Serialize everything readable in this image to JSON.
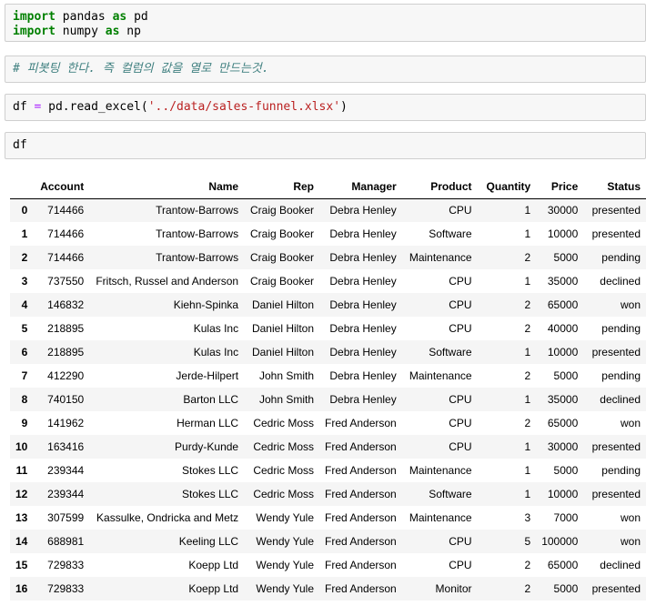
{
  "cells": {
    "import_code": {
      "line1": {
        "kw1": "import",
        "mod": " pandas ",
        "kw2": "as",
        "alias": " pd"
      },
      "line2": {
        "kw1": "import",
        "mod": " numpy ",
        "kw2": "as",
        "alias": " np"
      }
    },
    "comment": "# 피봇팅 한다. 즉 컬럼의 값을 열로 만드는것.",
    "read_code": {
      "pre": "df ",
      "eq": "=",
      "call": " pd.read_excel(",
      "str": "'../data/sales-funnel.xlsx'",
      "post": ")"
    },
    "df_code": "df"
  },
  "table": {
    "columns": [
      "",
      "Account",
      "Name",
      "Rep",
      "Manager",
      "Product",
      "Quantity",
      "Price",
      "Status"
    ],
    "rows": [
      [
        "0",
        "714466",
        "Trantow-Barrows",
        "Craig Booker",
        "Debra Henley",
        "CPU",
        "1",
        "30000",
        "presented"
      ],
      [
        "1",
        "714466",
        "Trantow-Barrows",
        "Craig Booker",
        "Debra Henley",
        "Software",
        "1",
        "10000",
        "presented"
      ],
      [
        "2",
        "714466",
        "Trantow-Barrows",
        "Craig Booker",
        "Debra Henley",
        "Maintenance",
        "2",
        "5000",
        "pending"
      ],
      [
        "3",
        "737550",
        "Fritsch, Russel and Anderson",
        "Craig Booker",
        "Debra Henley",
        "CPU",
        "1",
        "35000",
        "declined"
      ],
      [
        "4",
        "146832",
        "Kiehn-Spinka",
        "Daniel Hilton",
        "Debra Henley",
        "CPU",
        "2",
        "65000",
        "won"
      ],
      [
        "5",
        "218895",
        "Kulas Inc",
        "Daniel Hilton",
        "Debra Henley",
        "CPU",
        "2",
        "40000",
        "pending"
      ],
      [
        "6",
        "218895",
        "Kulas Inc",
        "Daniel Hilton",
        "Debra Henley",
        "Software",
        "1",
        "10000",
        "presented"
      ],
      [
        "7",
        "412290",
        "Jerde-Hilpert",
        "John Smith",
        "Debra Henley",
        "Maintenance",
        "2",
        "5000",
        "pending"
      ],
      [
        "8",
        "740150",
        "Barton LLC",
        "John Smith",
        "Debra Henley",
        "CPU",
        "1",
        "35000",
        "declined"
      ],
      [
        "9",
        "141962",
        "Herman LLC",
        "Cedric Moss",
        "Fred Anderson",
        "CPU",
        "2",
        "65000",
        "won"
      ],
      [
        "10",
        "163416",
        "Purdy-Kunde",
        "Cedric Moss",
        "Fred Anderson",
        "CPU",
        "1",
        "30000",
        "presented"
      ],
      [
        "11",
        "239344",
        "Stokes LLC",
        "Cedric Moss",
        "Fred Anderson",
        "Maintenance",
        "1",
        "5000",
        "pending"
      ],
      [
        "12",
        "239344",
        "Stokes LLC",
        "Cedric Moss",
        "Fred Anderson",
        "Software",
        "1",
        "10000",
        "presented"
      ],
      [
        "13",
        "307599",
        "Kassulke, Ondricka and Metz",
        "Wendy Yule",
        "Fred Anderson",
        "Maintenance",
        "3",
        "7000",
        "won"
      ],
      [
        "14",
        "688981",
        "Keeling LLC",
        "Wendy Yule",
        "Fred Anderson",
        "CPU",
        "5",
        "100000",
        "won"
      ],
      [
        "15",
        "729833",
        "Koepp Ltd",
        "Wendy Yule",
        "Fred Anderson",
        "CPU",
        "2",
        "65000",
        "declined"
      ],
      [
        "16",
        "729833",
        "Koepp Ltd",
        "Wendy Yule",
        "Fred Anderson",
        "Monitor",
        "2",
        "5000",
        "presented"
      ]
    ]
  }
}
